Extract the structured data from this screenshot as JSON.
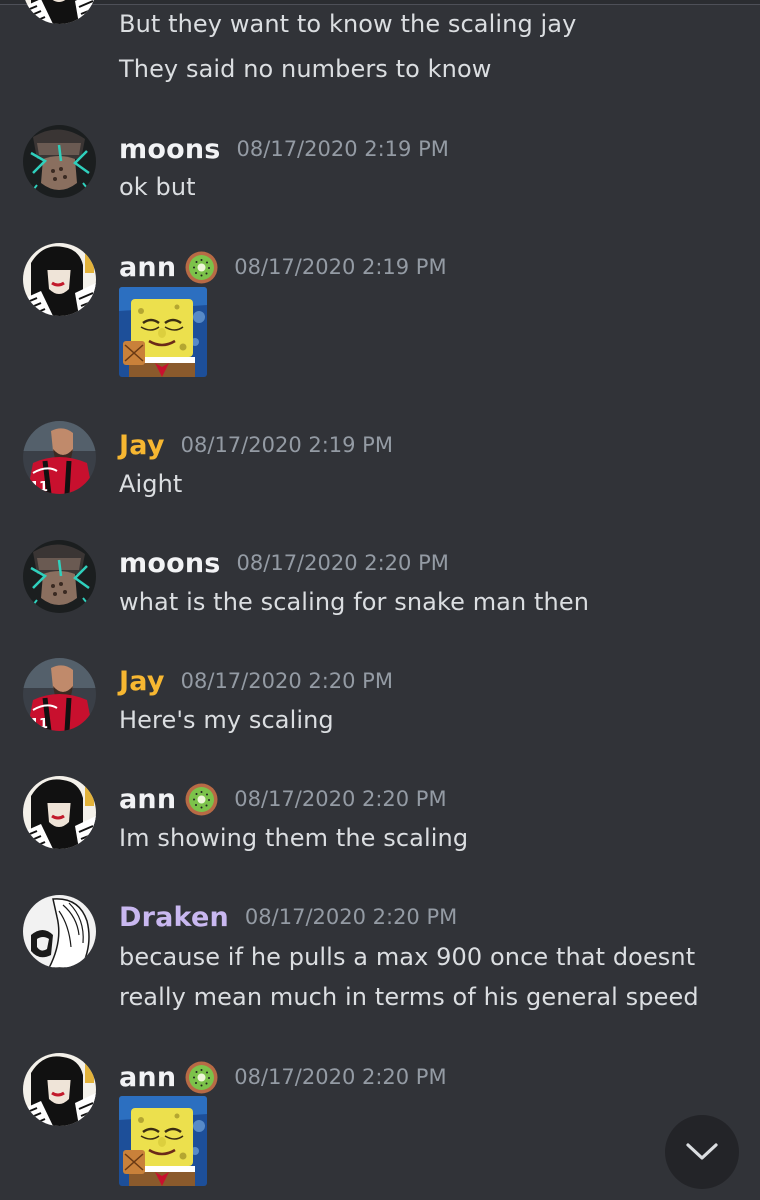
{
  "colors": {
    "background": "#313338",
    "username_default": "#f2f3f5",
    "username_jay": "#f7b731",
    "username_draken": "#c9b8f0",
    "timestamp": "#949ba4",
    "message_text": "#dbdee1"
  },
  "messages": [
    {
      "username": "",
      "timestamp": "",
      "lines": [
        "But they want to know the scaling jay",
        "They said no numbers to know"
      ]
    },
    {
      "username": "moons",
      "timestamp": "08/17/2020 2:19 PM",
      "lines": [
        "ok but"
      ]
    },
    {
      "username": "ann",
      "badge": "kiwi-emoji-icon",
      "timestamp": "08/17/2020 2:19 PM",
      "attachment": "spongebob-image"
    },
    {
      "username": "Jay",
      "timestamp": "08/17/2020 2:19 PM",
      "lines": [
        "Aight"
      ]
    },
    {
      "username": "moons",
      "timestamp": "08/17/2020 2:20 PM",
      "lines": [
        "what is the scaling for snake man then"
      ]
    },
    {
      "username": "Jay",
      "timestamp": "08/17/2020 2:20 PM",
      "lines": [
        "Here's my scaling"
      ]
    },
    {
      "username": "ann",
      "badge": "kiwi-emoji-icon",
      "timestamp": "08/17/2020 2:20 PM",
      "lines": [
        "Im showing them the scaling"
      ]
    },
    {
      "username": "Draken",
      "timestamp": "08/17/2020 2:20 PM",
      "lines": [
        "because if he pulls a max 900 once that doesnt",
        "really mean much in terms of his general speed"
      ]
    },
    {
      "username": "ann",
      "badge": "kiwi-emoji-icon",
      "timestamp": "08/17/2020 2:20 PM",
      "attachment": "spongebob-image"
    }
  ],
  "scroll_button": {
    "icon": "chevron-down-icon"
  }
}
